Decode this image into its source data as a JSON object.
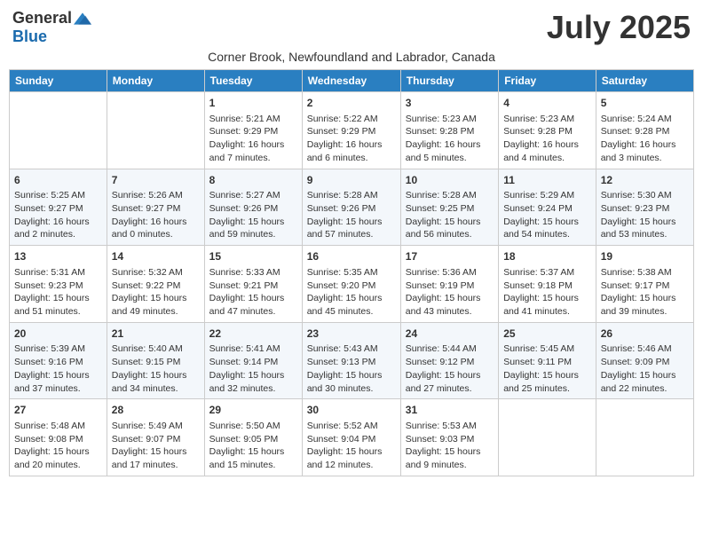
{
  "header": {
    "logo_general": "General",
    "logo_blue": "Blue",
    "month_title": "July 2025",
    "subtitle": "Corner Brook, Newfoundland and Labrador, Canada"
  },
  "days_of_week": [
    "Sunday",
    "Monday",
    "Tuesday",
    "Wednesday",
    "Thursday",
    "Friday",
    "Saturday"
  ],
  "weeks": [
    [
      {
        "day": "",
        "sunrise": "",
        "sunset": "",
        "daylight": ""
      },
      {
        "day": "",
        "sunrise": "",
        "sunset": "",
        "daylight": ""
      },
      {
        "day": "1",
        "sunrise": "Sunrise: 5:21 AM",
        "sunset": "Sunset: 9:29 PM",
        "daylight": "Daylight: 16 hours and 7 minutes."
      },
      {
        "day": "2",
        "sunrise": "Sunrise: 5:22 AM",
        "sunset": "Sunset: 9:29 PM",
        "daylight": "Daylight: 16 hours and 6 minutes."
      },
      {
        "day": "3",
        "sunrise": "Sunrise: 5:23 AM",
        "sunset": "Sunset: 9:28 PM",
        "daylight": "Daylight: 16 hours and 5 minutes."
      },
      {
        "day": "4",
        "sunrise": "Sunrise: 5:23 AM",
        "sunset": "Sunset: 9:28 PM",
        "daylight": "Daylight: 16 hours and 4 minutes."
      },
      {
        "day": "5",
        "sunrise": "Sunrise: 5:24 AM",
        "sunset": "Sunset: 9:28 PM",
        "daylight": "Daylight: 16 hours and 3 minutes."
      }
    ],
    [
      {
        "day": "6",
        "sunrise": "Sunrise: 5:25 AM",
        "sunset": "Sunset: 9:27 PM",
        "daylight": "Daylight: 16 hours and 2 minutes."
      },
      {
        "day": "7",
        "sunrise": "Sunrise: 5:26 AM",
        "sunset": "Sunset: 9:27 PM",
        "daylight": "Daylight: 16 hours and 0 minutes."
      },
      {
        "day": "8",
        "sunrise": "Sunrise: 5:27 AM",
        "sunset": "Sunset: 9:26 PM",
        "daylight": "Daylight: 15 hours and 59 minutes."
      },
      {
        "day": "9",
        "sunrise": "Sunrise: 5:28 AM",
        "sunset": "Sunset: 9:26 PM",
        "daylight": "Daylight: 15 hours and 57 minutes."
      },
      {
        "day": "10",
        "sunrise": "Sunrise: 5:28 AM",
        "sunset": "Sunset: 9:25 PM",
        "daylight": "Daylight: 15 hours and 56 minutes."
      },
      {
        "day": "11",
        "sunrise": "Sunrise: 5:29 AM",
        "sunset": "Sunset: 9:24 PM",
        "daylight": "Daylight: 15 hours and 54 minutes."
      },
      {
        "day": "12",
        "sunrise": "Sunrise: 5:30 AM",
        "sunset": "Sunset: 9:23 PM",
        "daylight": "Daylight: 15 hours and 53 minutes."
      }
    ],
    [
      {
        "day": "13",
        "sunrise": "Sunrise: 5:31 AM",
        "sunset": "Sunset: 9:23 PM",
        "daylight": "Daylight: 15 hours and 51 minutes."
      },
      {
        "day": "14",
        "sunrise": "Sunrise: 5:32 AM",
        "sunset": "Sunset: 9:22 PM",
        "daylight": "Daylight: 15 hours and 49 minutes."
      },
      {
        "day": "15",
        "sunrise": "Sunrise: 5:33 AM",
        "sunset": "Sunset: 9:21 PM",
        "daylight": "Daylight: 15 hours and 47 minutes."
      },
      {
        "day": "16",
        "sunrise": "Sunrise: 5:35 AM",
        "sunset": "Sunset: 9:20 PM",
        "daylight": "Daylight: 15 hours and 45 minutes."
      },
      {
        "day": "17",
        "sunrise": "Sunrise: 5:36 AM",
        "sunset": "Sunset: 9:19 PM",
        "daylight": "Daylight: 15 hours and 43 minutes."
      },
      {
        "day": "18",
        "sunrise": "Sunrise: 5:37 AM",
        "sunset": "Sunset: 9:18 PM",
        "daylight": "Daylight: 15 hours and 41 minutes."
      },
      {
        "day": "19",
        "sunrise": "Sunrise: 5:38 AM",
        "sunset": "Sunset: 9:17 PM",
        "daylight": "Daylight: 15 hours and 39 minutes."
      }
    ],
    [
      {
        "day": "20",
        "sunrise": "Sunrise: 5:39 AM",
        "sunset": "Sunset: 9:16 PM",
        "daylight": "Daylight: 15 hours and 37 minutes."
      },
      {
        "day": "21",
        "sunrise": "Sunrise: 5:40 AM",
        "sunset": "Sunset: 9:15 PM",
        "daylight": "Daylight: 15 hours and 34 minutes."
      },
      {
        "day": "22",
        "sunrise": "Sunrise: 5:41 AM",
        "sunset": "Sunset: 9:14 PM",
        "daylight": "Daylight: 15 hours and 32 minutes."
      },
      {
        "day": "23",
        "sunrise": "Sunrise: 5:43 AM",
        "sunset": "Sunset: 9:13 PM",
        "daylight": "Daylight: 15 hours and 30 minutes."
      },
      {
        "day": "24",
        "sunrise": "Sunrise: 5:44 AM",
        "sunset": "Sunset: 9:12 PM",
        "daylight": "Daylight: 15 hours and 27 minutes."
      },
      {
        "day": "25",
        "sunrise": "Sunrise: 5:45 AM",
        "sunset": "Sunset: 9:11 PM",
        "daylight": "Daylight: 15 hours and 25 minutes."
      },
      {
        "day": "26",
        "sunrise": "Sunrise: 5:46 AM",
        "sunset": "Sunset: 9:09 PM",
        "daylight": "Daylight: 15 hours and 22 minutes."
      }
    ],
    [
      {
        "day": "27",
        "sunrise": "Sunrise: 5:48 AM",
        "sunset": "Sunset: 9:08 PM",
        "daylight": "Daylight: 15 hours and 20 minutes."
      },
      {
        "day": "28",
        "sunrise": "Sunrise: 5:49 AM",
        "sunset": "Sunset: 9:07 PM",
        "daylight": "Daylight: 15 hours and 17 minutes."
      },
      {
        "day": "29",
        "sunrise": "Sunrise: 5:50 AM",
        "sunset": "Sunset: 9:05 PM",
        "daylight": "Daylight: 15 hours and 15 minutes."
      },
      {
        "day": "30",
        "sunrise": "Sunrise: 5:52 AM",
        "sunset": "Sunset: 9:04 PM",
        "daylight": "Daylight: 15 hours and 12 minutes."
      },
      {
        "day": "31",
        "sunrise": "Sunrise: 5:53 AM",
        "sunset": "Sunset: 9:03 PM",
        "daylight": "Daylight: 15 hours and 9 minutes."
      },
      {
        "day": "",
        "sunrise": "",
        "sunset": "",
        "daylight": ""
      },
      {
        "day": "",
        "sunrise": "",
        "sunset": "",
        "daylight": ""
      }
    ]
  ]
}
